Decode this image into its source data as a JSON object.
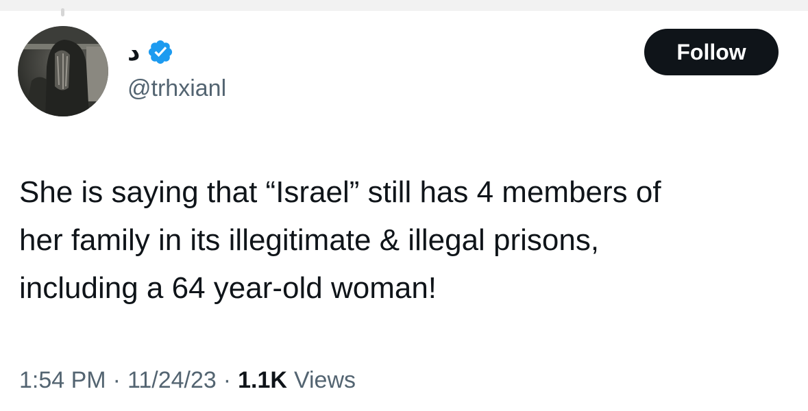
{
  "author": {
    "display_name": "د",
    "handle": "@trhxianl",
    "verified": true,
    "avatar_icon": "profile-photo"
  },
  "actions": {
    "follow_label": "Follow"
  },
  "tweet": {
    "text": "She is saying that “Israel” still has 4 members of\nher family in its illegitimate & illegal prisons,\nincluding a 64 year-old woman!"
  },
  "meta": {
    "time": "1:54 PM",
    "date": "11/24/23",
    "separator": "·",
    "views_count": "1.1K",
    "views_label": "Views"
  },
  "colors": {
    "text_primary": "#0f1419",
    "text_secondary": "#536471",
    "verified_blue": "#1d9bf0",
    "follow_bg": "#0f1419"
  }
}
